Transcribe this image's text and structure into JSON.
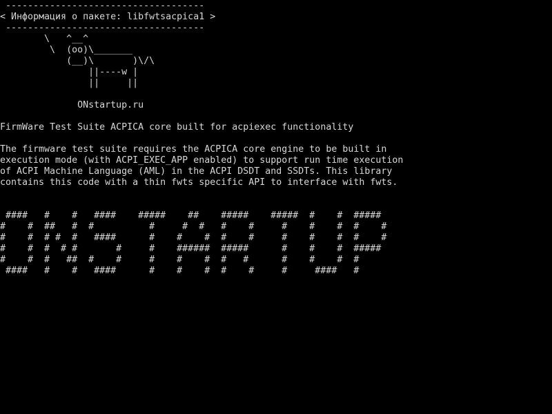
{
  "colors": {
    "background": "#000000",
    "text": "#d8d8d8"
  },
  "cowsay": {
    "top_border": " ------------------------------------",
    "message": "< Информация о пакете: libfwtsacpica1 >",
    "bottom_border": " ------------------------------------"
  },
  "cow": {
    "lines": [
      "        \\   ^__^",
      "         \\  (oo)\\_______",
      "            (__)\\       )\\/\\",
      "                ||----w |",
      "                ||     ||"
    ]
  },
  "site": "              ONstartup.ru",
  "package": {
    "headline": "FirmWare Test Suite ACPICA core built for acpiexec functionality",
    "description_lines": [
      "The firmware test suite requires the ACPICA core engine to be built in",
      "execution mode (with ACPI_EXEC_APP enabled) to support run time execution",
      "of ACPI Machine Language (AML) in the ACPI DSDT and SSDTs. This library",
      "contains this code with a thin fwts specific API to interface with fwts."
    ]
  },
  "banner": {
    "lines": [
      " ####   #    #   ####    #####    ##    #####    #####  #    #  #####",
      "#    #  ##   #  #          #     #  #   #    #     #    #    #  #    #",
      "#    #  # #  #   ####      #    #    #  #    #     #    #    #  #    #",
      "#    #  #  # #       #     #    ######  #####      #    #    #  #####",
      "#    #  #   ##  #    #     #    #    #  #   #      #    #    #  #",
      " ####   #    #   ####      #    #    #  #    #     #     ####   #"
    ]
  }
}
